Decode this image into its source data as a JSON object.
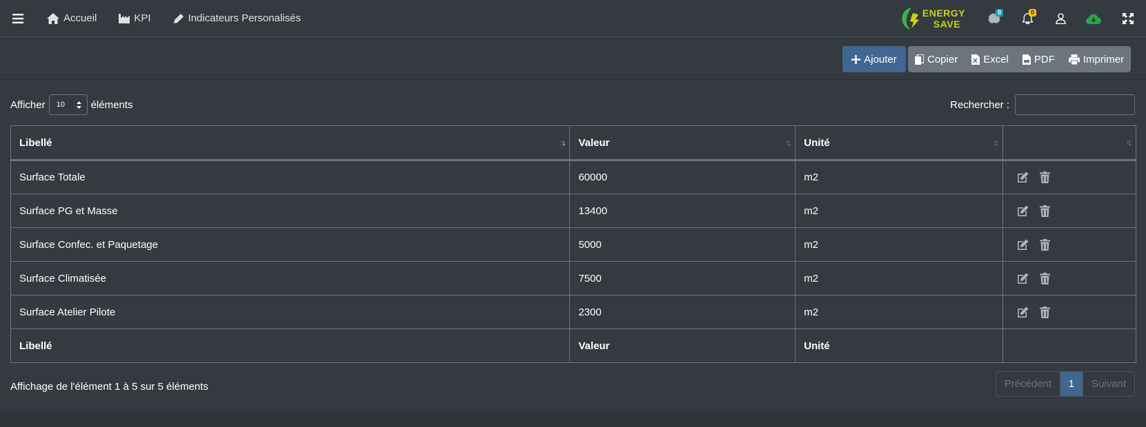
{
  "navbar": {
    "links": [
      {
        "label": "Accueil",
        "icon": "home-icon"
      },
      {
        "label": "KPI",
        "icon": "factory-icon"
      },
      {
        "label": "Indicateurs Personalisés",
        "icon": "pen-icon"
      }
    ],
    "logo": {
      "line1": "ENERGY",
      "line2": "SAVE"
    },
    "brain_badge": "0",
    "bell_badge": "0"
  },
  "toolbar": {
    "add_label": "Ajouter",
    "export_buttons": [
      {
        "label": "Copier",
        "icon": "copy-icon"
      },
      {
        "label": "Excel",
        "icon": "excel-icon"
      },
      {
        "label": "PDF",
        "icon": "pdf-icon"
      },
      {
        "label": "Imprimer",
        "icon": "print-icon"
      }
    ]
  },
  "length_control": {
    "prefix": "Afficher",
    "value": "10",
    "suffix": "éléments"
  },
  "search": {
    "label": "Rechercher :",
    "value": ""
  },
  "table": {
    "headers": [
      "Libellé",
      "Valeur",
      "Unité",
      ""
    ],
    "rows": [
      {
        "libelle": "Surface Totale",
        "valeur": "60000",
        "unite": "m2"
      },
      {
        "libelle": "Surface PG et Masse",
        "valeur": "13400",
        "unite": "m2"
      },
      {
        "libelle": "Surface Confec. et Paquetage",
        "valeur": "5000",
        "unite": "m2"
      },
      {
        "libelle": "Surface Climatisée",
        "valeur": "7500",
        "unite": "m2"
      },
      {
        "libelle": "Surface Atelier Pilote",
        "valeur": "2300",
        "unite": "m2"
      }
    ],
    "footers": [
      "Libellé",
      "Valeur",
      "Unité",
      ""
    ]
  },
  "info": "Affichage de l'élément 1 à 5 sur 5 éléments",
  "pagination": {
    "previous": "Précédent",
    "current": "1",
    "next": "Suivant"
  },
  "colors": {
    "background": "#343a40",
    "primary": "#3f6791",
    "secondary": "#6c757d",
    "logo_green": "#3bb34a",
    "logo_yellow": "#c6d418"
  }
}
